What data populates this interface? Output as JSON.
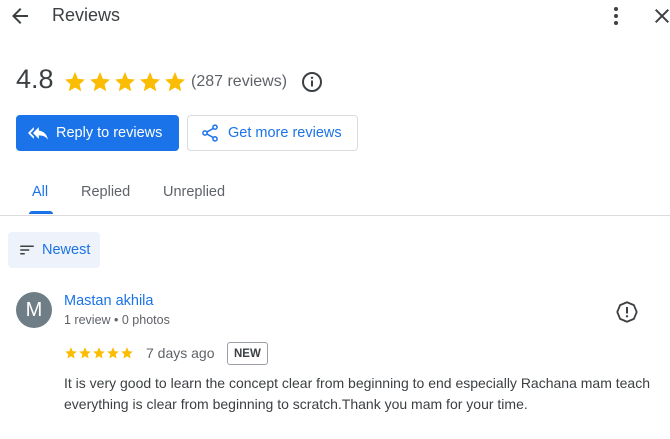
{
  "header": {
    "title": "Reviews"
  },
  "summary": {
    "rating": "4.8",
    "stars": 5,
    "review_count": "(287 reviews)"
  },
  "actions": {
    "reply_label": "Reply to reviews",
    "get_more_label": "Get more reviews"
  },
  "tabs": [
    {
      "label": "All",
      "active": true
    },
    {
      "label": "Replied",
      "active": false
    },
    {
      "label": "Unreplied",
      "active": false
    }
  ],
  "sort": {
    "label": "Newest"
  },
  "reviews": [
    {
      "avatar_initial": "M",
      "name": "Mastan akhila",
      "meta": "1 review • 0 photos",
      "stars": 5,
      "time": "7 days ago",
      "badge": "NEW",
      "text": "It is very good to learn the concept clear from beginning to end especially Rachana mam teach everything is clear from beginning to scratch.Thank you mam for your time."
    }
  ],
  "colors": {
    "accent": "#1a73e8",
    "star": "#fbbc04",
    "avatar": "#6f7d86"
  }
}
